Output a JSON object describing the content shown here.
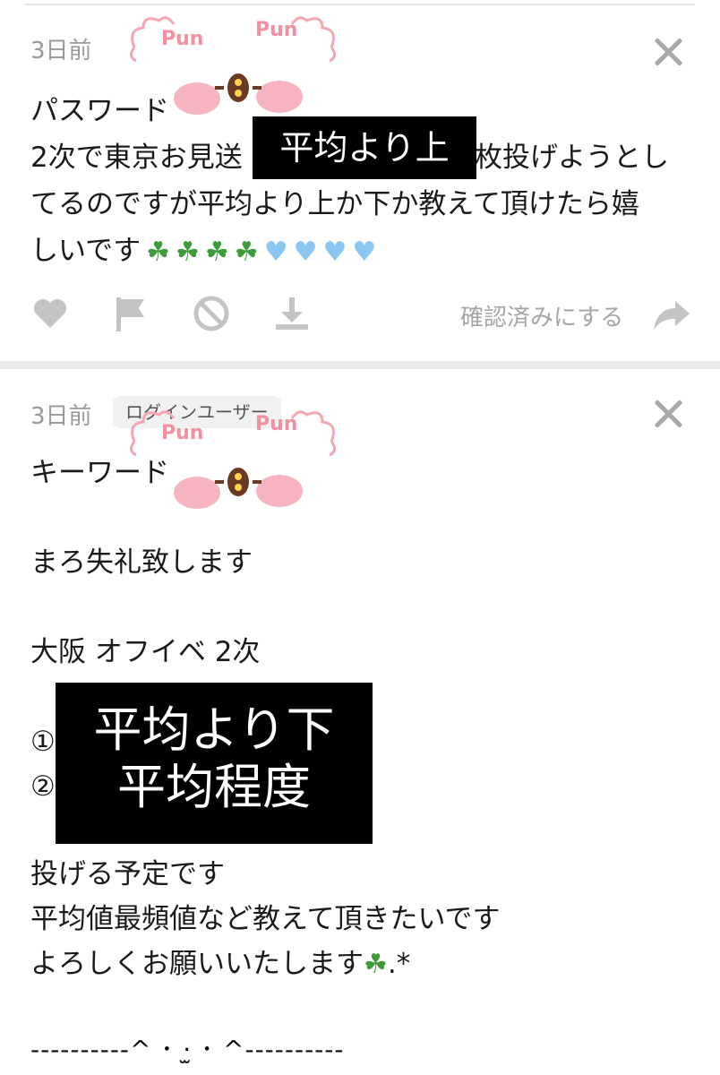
{
  "card1": {
    "timestamp": "3日前",
    "line1": "パスワード",
    "line2_prefix": "2次で東京お見送",
    "line2_suffix": "枚投げようとし",
    "line3": "てるのですが平均より上か下か教えて頂けたら嬉",
    "line4": "しいです",
    "redaction": "平均より上",
    "sticker_text_left": "Pun",
    "sticker_text_right": "Pun",
    "confirm_label": "確認済みにする",
    "icons": [
      "heart-icon",
      "flag-icon",
      "block-icon",
      "download-icon",
      "share-arrow-icon"
    ]
  },
  "card2": {
    "timestamp": "3日前",
    "badge": "ログインユーザー",
    "line1": "キーワード",
    "line2": "まろ失礼致します",
    "line3": "大阪 オフイベ 2次",
    "item1_marker": "①",
    "item2_marker": "②",
    "redaction_line1": "平均より下",
    "redaction_line2": "平均程度",
    "line4": "投げる予定です",
    "line5": "平均値最頻値など教えて頂きたいです",
    "line6": "よろしくお願いいたします",
    "line6_suffix": ".*",
    "footer": "----------^ ･ ·̫ ･ ^----------"
  },
  "colors": {
    "clover": "#3e9b3a",
    "heart_blue": "#8cc7f3",
    "icon_gray": "#c4c4c4",
    "text_gray": "#9a9a9a"
  }
}
